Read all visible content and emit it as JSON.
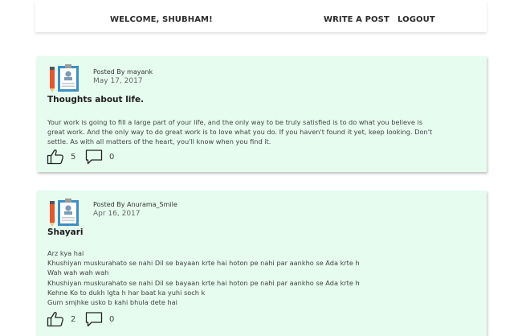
{
  "nav": {
    "welcome": "WELCOME, SHUBHAM!",
    "write_post": "WRITE A POST",
    "logout": "LOGOUT"
  },
  "posts": [
    {
      "posted_by": "Posted By mayank",
      "date": "May 17, 2017",
      "title": "Thoughts about life.",
      "body_lines": [
        "Your work is going to fill a large part of your life, and the only way to be truly satisfied is to do what you believe is",
        "great work. And the only way to do great work is to love what you do. If you haven't found it yet, keep looking. Don't",
        "settle. As with all matters of the heart, you'll know when you find it."
      ],
      "likes": "5",
      "comments": "0"
    },
    {
      "posted_by": "Posted By Anurama_Smile",
      "date": "Apr 16, 2017",
      "title": "Shayari",
      "body_lines": [
        "Arz kya hai",
        "Khushiyan muskurahato se nahi Dil se bayaan krte hai hoton pe nahi par aankho se Ada krte h",
        "Wah wah wah wah",
        "Khushiyan muskurahato se nahi Dil se bayaan krte hai hoton pe nahi par aankho se Ada krte h",
        "Kehne Ko to dukh lgta h har baat ka yuhi soch k",
        "Gum smjhke usko b kahi bhula dete hai"
      ],
      "likes": "2",
      "comments": "0"
    }
  ],
  "icons": {
    "avatar": "profile-document-icon",
    "like": "thumbs-up-icon",
    "comment": "comment-icon"
  },
  "colors": {
    "card_bg": "#e5fcef",
    "avatar_pencil": "#e8552f",
    "avatar_board": "#3b8fc4"
  }
}
